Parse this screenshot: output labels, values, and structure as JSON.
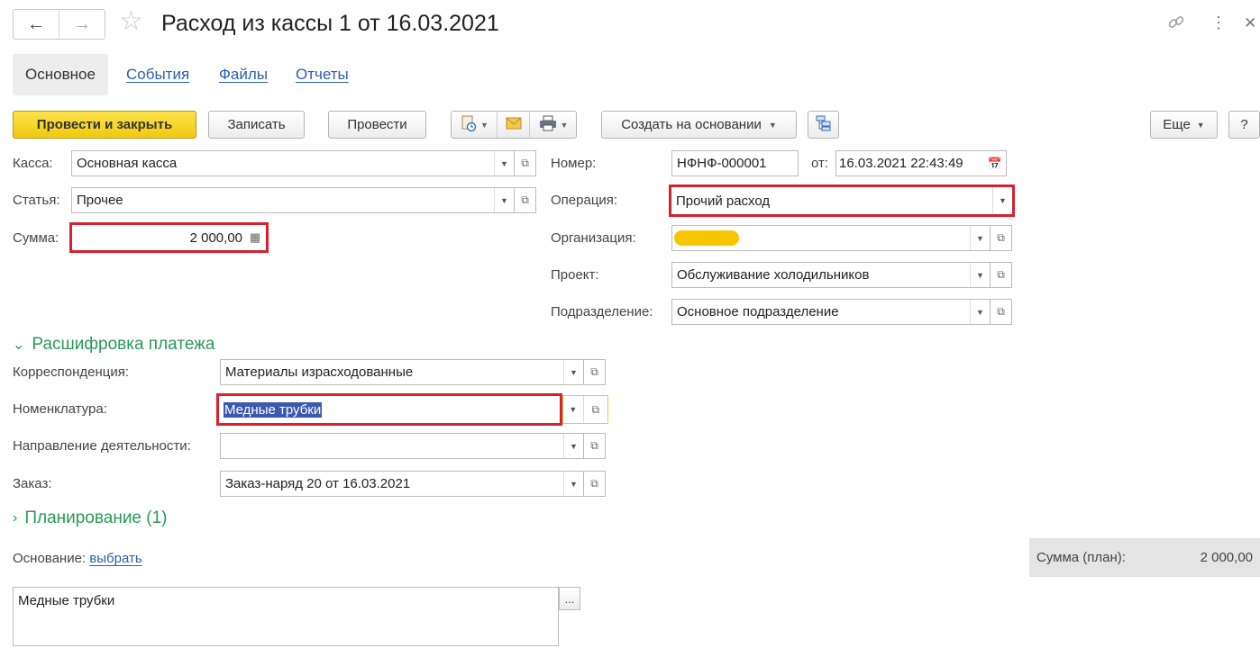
{
  "header": {
    "title": "Расход из кассы 1 от 16.03.2021",
    "back_icon": "arrow-left-icon",
    "forward_icon": "arrow-right-icon",
    "favorite_icon": "star-icon",
    "link_icon": "link-icon",
    "more_icon": "vertical-dots-icon",
    "close_icon": "close-icon"
  },
  "tabs": [
    {
      "label": "Основное",
      "active": true
    },
    {
      "label": "События"
    },
    {
      "label": "Файлы"
    },
    {
      "label": "Отчеты"
    }
  ],
  "toolbar": {
    "post_close": "Провести и закрыть",
    "save": "Записать",
    "post": "Провести",
    "create_based": "Создать на основании",
    "more": "Еще",
    "help": "?"
  },
  "form": {
    "kassa": {
      "label": "Касса:",
      "value": "Основная касса"
    },
    "statya": {
      "label": "Статья:",
      "value": "Прочее"
    },
    "summa": {
      "label": "Сумма:",
      "value": "2 000,00"
    },
    "nomer": {
      "label": "Номер:",
      "value": "НФНФ-000001"
    },
    "date": {
      "label": "от:",
      "value": "16.03.2021 22:43:49"
    },
    "operation": {
      "label": "Операция:",
      "value": "Прочий расход"
    },
    "organization": {
      "label": "Организация:",
      "value": ""
    },
    "project": {
      "label": "Проект:",
      "value": "Обслуживание холодильников"
    },
    "division": {
      "label": "Подразделение:",
      "value": "Основное подразделение"
    }
  },
  "breakdown": {
    "title": "Расшифровка платежа",
    "correspondence": {
      "label": "Корреспонденция:",
      "value": "Материалы израсходованные"
    },
    "nomenclature": {
      "label": "Номенклатура:",
      "value": "Медные трубки"
    },
    "activity": {
      "label": "Направление деятельности:",
      "value": ""
    },
    "order": {
      "label": "Заказ:",
      "value": "Заказ-наряд 20 от 16.03.2021"
    }
  },
  "planning": {
    "title": "Планирование (1)"
  },
  "basis": {
    "label": "Основание:",
    "link": "выбрать"
  },
  "plan_sum": {
    "label": "Сумма (план):",
    "value": "2 000,00"
  },
  "comment": {
    "value": "Медные трубки",
    "button": "..."
  },
  "colors": {
    "highlight": "#d8202f",
    "accent": "#2a9a55",
    "primary_button": "#f2c80f",
    "redaction": "#f7c600"
  }
}
